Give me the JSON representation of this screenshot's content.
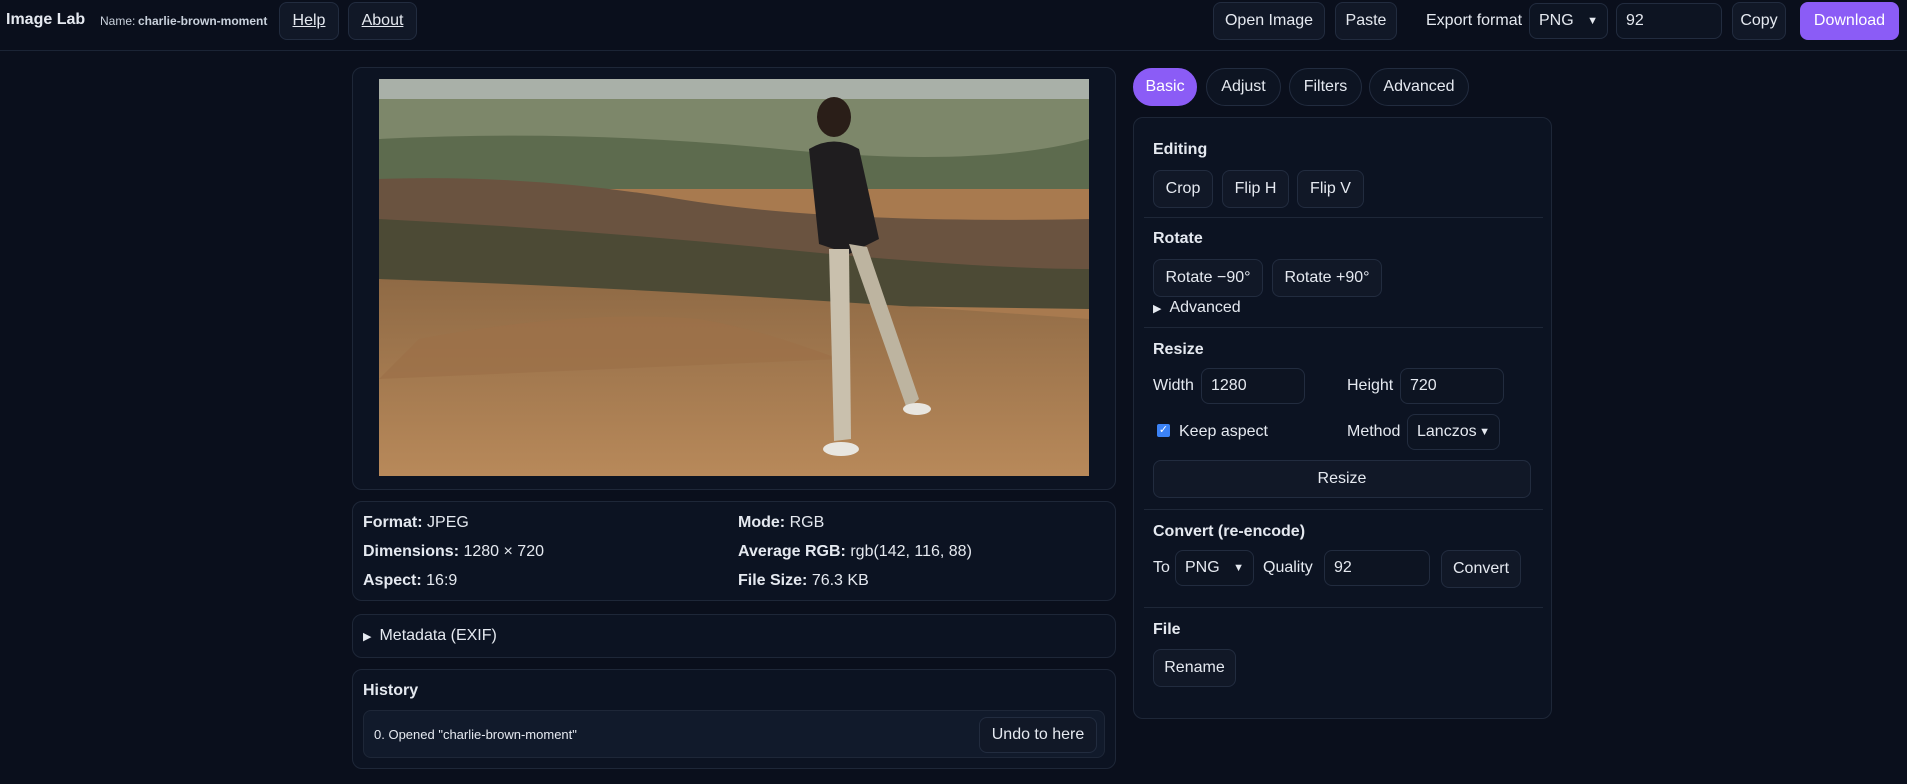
{
  "app": {
    "title": "Image Lab",
    "name_label": "Name:",
    "name_value": "charlie-brown-moment",
    "help_label": "Help",
    "about_label": "About"
  },
  "toolbar": {
    "open_label": "Open Image",
    "paste_label": "Paste",
    "export_format_label": "Export format",
    "export_format_value": "PNG",
    "quality_value": "92",
    "copy_label": "Copy",
    "download_label": "Download"
  },
  "info": {
    "format_label": "Format:",
    "format_value": "JPEG",
    "mode_label": "Mode:",
    "mode_value": "RGB",
    "dimensions_label": "Dimensions:",
    "dimensions_value": "1280 × 720",
    "avg_label": "Average RGB:",
    "avg_value": "rgb(142, 116, 88)",
    "aspect_label": "Aspect:",
    "aspect_value": "16:9",
    "size_label": "File Size:",
    "size_value": "76.3 KB"
  },
  "metadata": {
    "label": "Metadata (EXIF)"
  },
  "history": {
    "title": "History",
    "items": [
      {
        "text": "0. Opened \"charlie-brown-moment\"",
        "undo_label": "Undo to here"
      }
    ]
  },
  "tabs": [
    "Basic",
    "Adjust",
    "Filters",
    "Advanced"
  ],
  "editing": {
    "title": "Editing",
    "crop_label": "Crop",
    "fliph_label": "Flip H",
    "flipv_label": "Flip V"
  },
  "rotate": {
    "title": "Rotate",
    "minus_label": "Rotate −90°",
    "plus_label": "Rotate +90°",
    "advanced_label": "Advanced"
  },
  "resize": {
    "title": "Resize",
    "width_label": "Width",
    "width_value": "1280",
    "height_label": "Height",
    "height_value": "720",
    "keep_aspect_label": "Keep aspect",
    "keep_aspect_checked": true,
    "method_label": "Method",
    "method_value": "Lanczos",
    "button_label": "Resize"
  },
  "convert": {
    "title": "Convert (re-encode)",
    "to_label": "To",
    "to_value": "PNG",
    "quality_label": "Quality",
    "quality_value": "92",
    "button_label": "Convert"
  },
  "file": {
    "title": "File",
    "rename_label": "Rename"
  },
  "colors": {
    "accent": "#8b5cf6",
    "background": "#0a0f1c",
    "panel": "#0c1322"
  }
}
